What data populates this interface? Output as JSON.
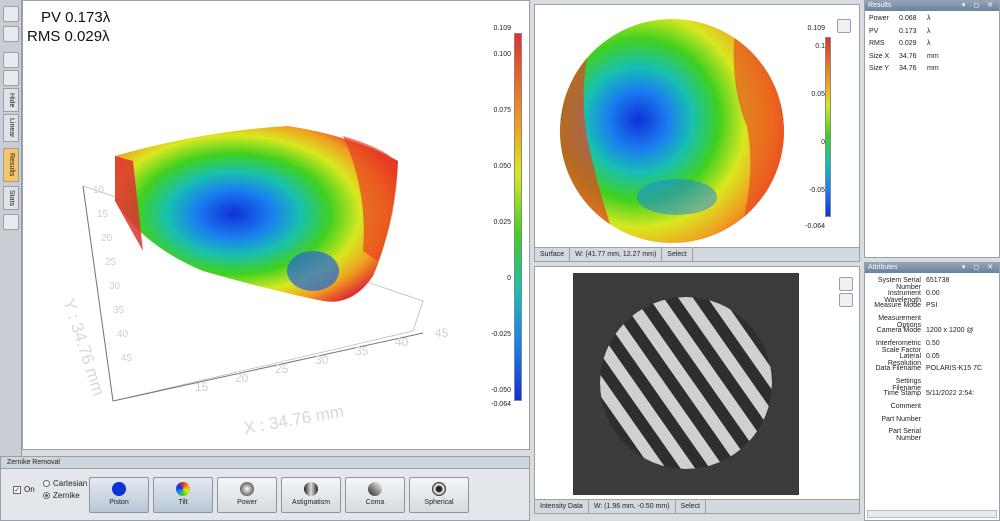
{
  "stats_overlay": {
    "pv": "PV 0.173λ",
    "rms": "RMS 0.029λ"
  },
  "left_tabs": {
    "hide": "Hide",
    "linear": "Linear",
    "results": "Results",
    "stats": "Stats"
  },
  "axes3d": {
    "y_label": "Y : 34.76 mm",
    "x_label": "X : 34.76 mm",
    "x_ticks": [
      "15",
      "20",
      "25",
      "30",
      "35",
      "40",
      "45"
    ],
    "y_ticks": [
      "10",
      "15",
      "20",
      "25",
      "30",
      "35",
      "40",
      "45"
    ]
  },
  "colorbar_main": {
    "top": "0.109",
    "bottom": "-0.064",
    "ticks": [
      "0.100",
      "0.075",
      "0.050",
      "0.025",
      "0",
      "-0.025",
      "-0.050"
    ]
  },
  "colorbar_small": {
    "top": "0.109",
    "bottom": "-0.064",
    "ticks": [
      "0.1",
      "0.05",
      "0",
      "-0.05"
    ]
  },
  "surface_status": {
    "mode": "Surface",
    "coord": "W: (41.77 mm, 12.27 mm)",
    "select": "Select"
  },
  "intensity_status": {
    "mode": "Intensity Data",
    "coord": "W: (1.96 mm, -0.50 mm)",
    "select": "Select"
  },
  "results": {
    "title": "Results",
    "rows": [
      {
        "label": "Power",
        "value": "0.068",
        "unit": "λ"
      },
      {
        "label": "PV",
        "value": "0.173",
        "unit": "λ"
      },
      {
        "label": "RMS",
        "value": "0.029",
        "unit": "λ"
      },
      {
        "label": "Size X",
        "value": "34.76",
        "unit": "mm"
      },
      {
        "label": "Size Y",
        "value": "34.76",
        "unit": "mm"
      }
    ]
  },
  "attributes": {
    "title": "Attributes",
    "rows": [
      {
        "label": "System Serial Number",
        "value": "651738"
      },
      {
        "label": "Instrument Wavelength",
        "value": "0.00"
      },
      {
        "label": "Measure Mode",
        "value": "PSI"
      },
      {
        "label": "Measurement Options",
        "value": ""
      },
      {
        "label": "Camera Mode",
        "value": "1200 x 1200 @"
      },
      {
        "label": "Interferometric Scale Factor",
        "value": "0.50"
      },
      {
        "label": "Lateral Resolution",
        "value": "0.05"
      },
      {
        "label": "Data Filename",
        "value": "POLARIS-K15 7C"
      },
      {
        "label": "Settings Filename",
        "value": ""
      },
      {
        "label": "Time Stamp",
        "value": "5/11/2022 2:54:"
      },
      {
        "label": "Comment",
        "value": ""
      },
      {
        "label": "Part Number",
        "value": ""
      },
      {
        "label": "Part Serial Number",
        "value": ""
      }
    ]
  },
  "zernike": {
    "title": "Zernike Removal",
    "on_label": "On",
    "cartesian_label": "Cartesian",
    "zernike_label": "Zernike",
    "buttons": [
      "Piston",
      "Tilt",
      "Power",
      "Astigmatism",
      "Coma",
      "Spherical"
    ]
  },
  "colors": {
    "accent": "#f5c56a",
    "header": "#6c819a"
  }
}
